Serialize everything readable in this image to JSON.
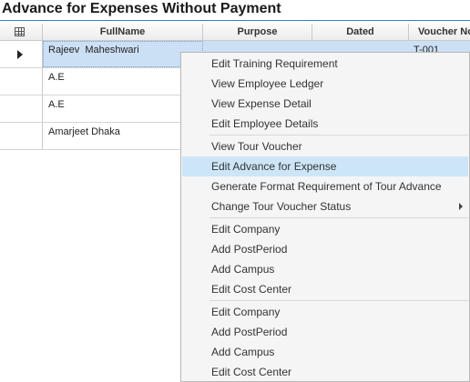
{
  "title": "Advance for Expenses Without Payment",
  "columns": {
    "full_name": "FullName",
    "purpose": "Purpose",
    "dated": "Dated",
    "voucher_no": "Voucher No"
  },
  "rows": [
    {
      "full_name": "Rajeev  Maheshwari",
      "voucher_no": "T-001"
    },
    {
      "full_name": "A.E",
      "voucher_no": ""
    },
    {
      "full_name": "A.E",
      "voucher_no": ""
    },
    {
      "full_name": "Amarjeet Dhaka",
      "voucher_no": ""
    }
  ],
  "context_menu": {
    "items": [
      "Edit Training Requirement",
      "View Employee Ledger",
      "View Expense Detail",
      "Edit Employee Details",
      "View Tour Voucher",
      "Edit Advance for Expense",
      "Generate Format Requirement of Tour Advance",
      "Change Tour Voucher Status",
      "Edit Company",
      "Add PostPeriod",
      "Add Campus",
      "Edit Cost Center",
      "Edit Company",
      "Add PostPeriod",
      "Add Campus",
      "Edit Cost Center"
    ],
    "highlighted_item": "Edit Advance for Expense"
  },
  "colors": {
    "title_underline": "#3d7fc1",
    "row_selected": "#cce0f5",
    "menu_highlight": "#cde6f7",
    "menu_background": "#f5f5f5"
  },
  "icons": {
    "column_chooser": "grid-icon",
    "row_indicator": "row-pointer-icon",
    "submenu": "chevron-right-icon"
  }
}
